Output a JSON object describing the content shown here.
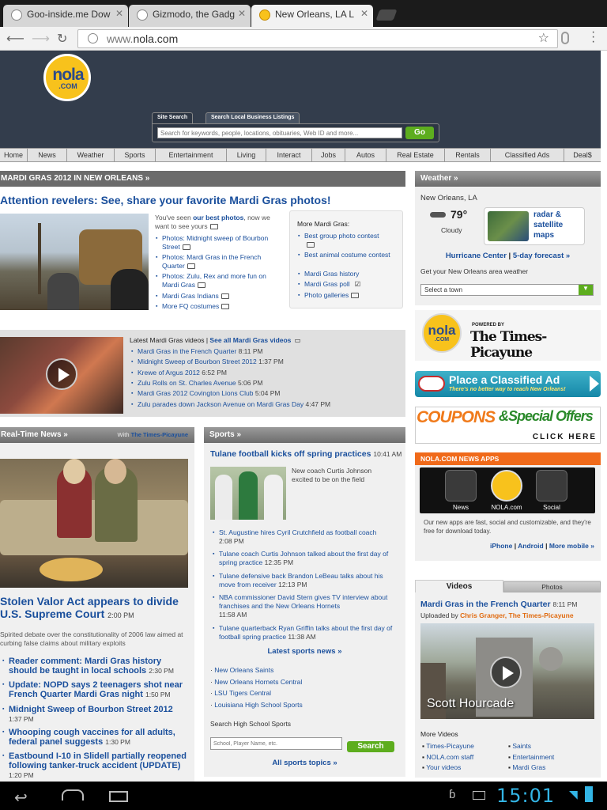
{
  "browser": {
    "tabs": [
      {
        "title": "Goo-inside.me Dow",
        "active": false
      },
      {
        "title": "Gizmodo, the Gadg",
        "active": false
      },
      {
        "title": "New Orleans, LA L",
        "active": true
      }
    ],
    "url_prefix": "www.",
    "url_domain": "nola.com"
  },
  "header": {
    "logo_text": "nola",
    "logo_sub": ".COM",
    "search_tab_site": "Site Search",
    "search_tab_local": "Search Local Business Listings",
    "search_placeholder": "Search for keywords, people, locations, obituaries, Web ID and more...",
    "go_label": "Go"
  },
  "nav": [
    "Home",
    "News",
    "Weather",
    "Sports",
    "Entertainment",
    "Living",
    "Interact",
    "Jobs",
    "Autos",
    "Real Estate",
    "Rentals",
    "Classified Ads",
    "Deal$"
  ],
  "mardi_gras": {
    "section_title": "MARDI GRAS 2012 IN NEW ORLEANS »",
    "headline": "Attention revelers: See, share your favorite Mardi Gras photos!",
    "intro_pre": "You've seen ",
    "intro_link": "our best photos",
    "intro_post": ", now we want to see yours",
    "links": [
      "Photos: Midnight sweep of Bourbon Street",
      "Photos: Mardi Gras in the French Quarter",
      "Photos: Zulu, Rex and more fun on Mardi Gras",
      "Mardi Gras Indians",
      "More FQ costumes"
    ],
    "more_title": "More Mardi Gras:",
    "more_links": [
      "Best group photo contest",
      "Best animal costume contest",
      "Mardi Gras history",
      "Mardi Gras poll",
      "Photo galleries"
    ],
    "videos_title": "Latest Mardi Gras videos | ",
    "videos_all": "See all Mardi Gras videos",
    "videos": [
      {
        "title": "Mardi Gras in the French Quarter",
        "time": "8:11 PM"
      },
      {
        "title": "Midnight Sweep of Bourbon Street 2012",
        "time": "1:37 PM"
      },
      {
        "title": "Krewe of Argus 2012",
        "time": "6:52 PM"
      },
      {
        "title": "Zulu Rolls on St. Charles Avenue",
        "time": "5:06 PM"
      },
      {
        "title": "Mardi Gras 2012 Covington Lions Club",
        "time": "5:04 PM"
      },
      {
        "title": "Zulu parades down Jackson Avenue on Mardi Gras Day",
        "time": "4:47 PM"
      }
    ]
  },
  "realtime": {
    "title": "Real-Time News »",
    "with_label": "With ",
    "with_brand": "The Times-Picayune",
    "headline": "Stolen Valor Act appears to divide U.S. Supreme Court",
    "headline_time": "2:00 PM",
    "summary": "Spirited debate over the constitutionality of 2006 law aimed at curbing false claims about military exploits",
    "items": [
      {
        "title": "Reader comment: Mardi Gras history should be taught in local schools",
        "time": "2:30 PM"
      },
      {
        "title": "Update: NOPD says 2 teenagers shot near French Quarter Mardi Gras night",
        "time": "1:50 PM"
      },
      {
        "title": "Midnight Sweep of Bourbon Street 2012",
        "time": "1:37 PM"
      },
      {
        "title": "Whooping cough vaccines for all adults, federal panel suggests",
        "time": "1:30 PM"
      },
      {
        "title": "Eastbound I-10 in Slidell partially reopened following tanker-truck accident (UPDATE)",
        "time": "1:20 PM"
      }
    ]
  },
  "sports": {
    "title": "Sports »",
    "headline": "Tulane football kicks off spring practices",
    "headline_time": "10:41 AM",
    "photo_caption": "New coach Curtis Johnson excited to be on the field",
    "items": [
      {
        "title": "St. Augustine hires Cyril Crutchfield as football coach",
        "time": "2:08 PM"
      },
      {
        "title": "Tulane coach Curtis Johnson talked about the first day of spring practice",
        "time": "12:35 PM"
      },
      {
        "title": "Tulane defensive back Brandon LeBeau talks about his move from receiver",
        "time": "12:13 PM"
      },
      {
        "title": "NBA commissioner David Stern gives TV interview about franchises and the New Orleans Hornets",
        "time": "11:58 AM"
      },
      {
        "title": "Tulane quarterback Ryan Griffin talks about the first day of football spring practice",
        "time": "11:38 AM"
      }
    ],
    "latest_link": "Latest sports news »",
    "teams": [
      "New Orleans Saints",
      "New Orleans Hornets Central",
      "LSU Tigers Central",
      "Louisiana High School Sports"
    ],
    "hs_title": "Search High School Sports",
    "hs_placeholder": "School, Player Name, etc.",
    "hs_button": "Search",
    "all_topics": "All sports topics »"
  },
  "weather": {
    "title": "Weather »",
    "city": "New Orleans, LA",
    "temp": "79°",
    "condition": "Cloudy",
    "radar_label": "radar & satellite maps",
    "hurricane": "Hurricane Center",
    "forecast": "5-day forecast »",
    "town_prompt": "Get your New Orleans area weather",
    "town_select": "Select a town"
  },
  "ads": {
    "tp_powered": "POWERED BY",
    "tp_brand": "The Times-Picayune",
    "classified_main": "Place a Classified Ad",
    "classified_sub": "There's no better way to reach New Orleans!",
    "coupons": "COUPONS",
    "special": "&Special Offers",
    "click": "CLICK HERE"
  },
  "apps": {
    "title": "NOLA.COM NEWS APPS",
    "labels": [
      "News",
      "NOLA.com",
      "Social"
    ],
    "desc": "Our new apps are fast, social and customizable, and they're free for download today.",
    "links": [
      "iPhone",
      "Android",
      "More mobile »"
    ]
  },
  "videos": {
    "tab_videos": "Videos",
    "tab_photos": "Photos",
    "headline": "Mardi Gras in the French Quarter",
    "headline_time": "8:11 PM",
    "uploaded_by": "Uploaded by ",
    "uploader": "Chris Granger, The Times-Picayune",
    "overlay": "Scott Hourcade",
    "more_title": "More Videos",
    "more_left": [
      "Times-Picayune",
      "NOLA.com staff",
      "Your videos"
    ],
    "more_right": [
      "Saints",
      "Entertainment",
      "Mardi Gras"
    ]
  },
  "status": {
    "time": "15:01"
  },
  "colors": {
    "header_bg": "#333d4c",
    "link": "#1a4f9c",
    "nola_yellow": "#f8c21c",
    "apps_orange": "#f06a1a",
    "go_green": "#5dad1e"
  }
}
